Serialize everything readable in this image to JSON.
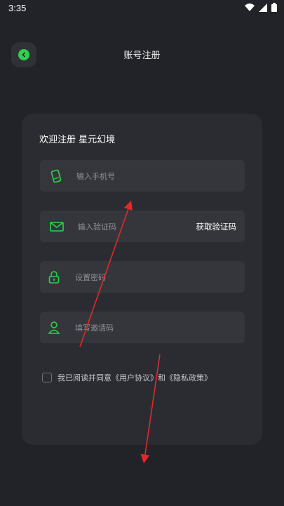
{
  "status_bar": {
    "time": "3:35",
    "icons": [
      "wifi-icon",
      "signal-icon",
      "battery-icon"
    ]
  },
  "header": {
    "title": "账号注册",
    "back_icon": "back-icon"
  },
  "card": {
    "welcome": "欢迎注册 星元幻境",
    "fields": [
      {
        "name": "phone",
        "icon": "phone-icon",
        "placeholder": "输入手机号"
      },
      {
        "name": "code",
        "icon": "mail-icon",
        "placeholder": "输入验证码",
        "action": "获取验证码"
      },
      {
        "name": "password",
        "icon": "lock-icon",
        "placeholder": "设置密码"
      },
      {
        "name": "invite",
        "icon": "user-icon",
        "placeholder": "填写邀请码"
      }
    ],
    "agreement": "我已阅读并同意《用户协议》和《隐私政策》"
  },
  "colors": {
    "background": "#222328",
    "card": "#2b2c31",
    "field": "#35363c",
    "accent": "#30d04c",
    "annotation_arrow": "#e02a2a"
  }
}
